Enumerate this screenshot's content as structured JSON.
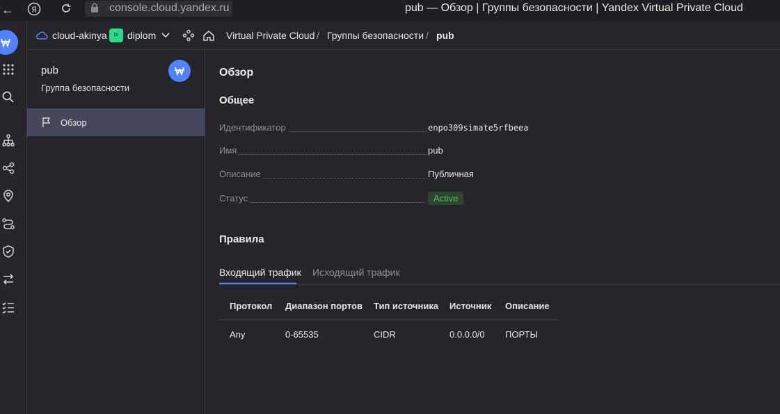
{
  "browser": {
    "url": "console.cloud.yandex.ru",
    "window_title": "pub — Обзор | Группы безопасности | Yandex Virtual Private Cloud"
  },
  "header": {
    "cloud_name": "cloud-akinya",
    "folder_badge": "DI",
    "folder_name": "diplom",
    "breadcrumb": [
      "Virtual Private Cloud",
      "Группы безопасности",
      "pub"
    ]
  },
  "subnav": {
    "title": "pub",
    "subtitle": "Группа безопасности",
    "items": [
      {
        "label": "Обзор",
        "icon": "flag-icon",
        "active": true
      }
    ]
  },
  "main": {
    "page_title": "Обзор",
    "general_heading": "Общее",
    "properties": [
      {
        "key": "Идентификатор",
        "value": "enpo309simate5rfbeea"
      },
      {
        "key": "Имя",
        "value": "pub"
      },
      {
        "key": "Описание",
        "value": "Публичная"
      },
      {
        "key": "Статус",
        "value": "Active"
      }
    ],
    "rules_heading": "Правила",
    "tabs": [
      {
        "label": "Входящий трафик",
        "active": true
      },
      {
        "label": "Исходящий трафик",
        "active": false
      }
    ],
    "table": {
      "columns": [
        "Протокол",
        "Диапазон портов",
        "Тип источника",
        "Источник",
        "Описание"
      ],
      "rows": [
        [
          "Any",
          "0-65535",
          "CIDR",
          "0.0.0.0/0",
          "ПОРТЫ"
        ]
      ]
    }
  },
  "colors": {
    "accent": "#5282ff",
    "status_active": "#58b86a",
    "folder_badge": "#2bd98c"
  }
}
